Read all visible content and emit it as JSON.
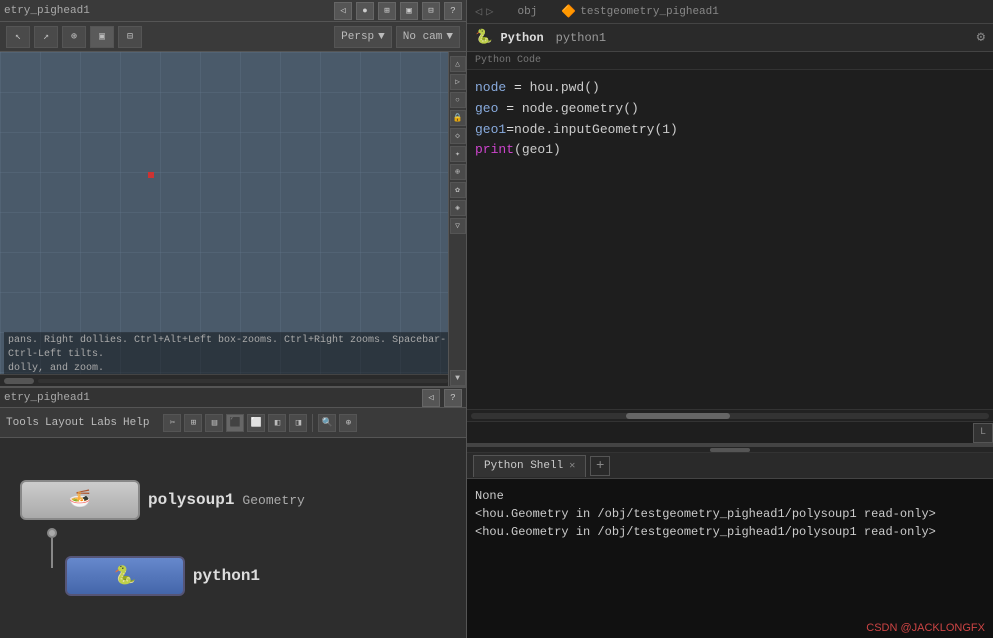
{
  "left": {
    "viewport_title": "etry_pighead1",
    "persp_label": "Persp",
    "cam_label": "No cam",
    "hint_text": "pans. Right dollies. Ctrl+Alt+Left box-zooms. Ctrl+Right zooms. Spacebar-Ctrl-Left tilts.\ndolly, and zoom.",
    "network_title": "etry_pighead1",
    "node1_label": "polysoup1",
    "node1_sublabel": "Geometry",
    "node2_label": "python1",
    "toolbar_icons": [
      "↖",
      "↗",
      "⊕",
      "▣",
      "⊟",
      "◉"
    ],
    "side_icons": [
      "△",
      "▷",
      "○",
      "◇",
      "✦",
      "⊕",
      "✿",
      "◈",
      "⊞"
    ],
    "network_tools": [
      "✂",
      "⊞",
      "▤",
      "⬛",
      "⬜",
      "⬛",
      "⬜",
      "◧",
      "◨",
      "◉",
      "◎",
      "⊕",
      "✦"
    ],
    "tabs": [
      "Tools",
      "Layout",
      "Labs",
      "Help"
    ]
  },
  "right": {
    "tab_obj": "obj",
    "tab_node": "testgeometry_pighead1",
    "python_label": "Python",
    "python_sublabel": "python1",
    "code_section_label": "Python Code",
    "code_lines": [
      {
        "text": "node = hou.pwd()",
        "type": "white"
      },
      {
        "text": "geo = node.geometry()",
        "type": "white"
      },
      {
        "text": "geo1=node.inputGeometry(1)",
        "type": "white"
      },
      {
        "text": "print(geo1)",
        "type": "print"
      }
    ],
    "shell_tab_label": "Python Shell",
    "shell_output": [
      {
        "text": "None",
        "type": "normal"
      },
      {
        "text": "<hou.Geometry in /obj/testgeometry_pighead1/polysoup1 read-only>",
        "type": "normal"
      },
      {
        "text": "<hou.Geometry in /obj/testgeometry_pighead1/polysoup1 read-only>",
        "type": "normal"
      }
    ],
    "watermark": "CSDN @JACKLONGFX",
    "input_label": "L"
  }
}
